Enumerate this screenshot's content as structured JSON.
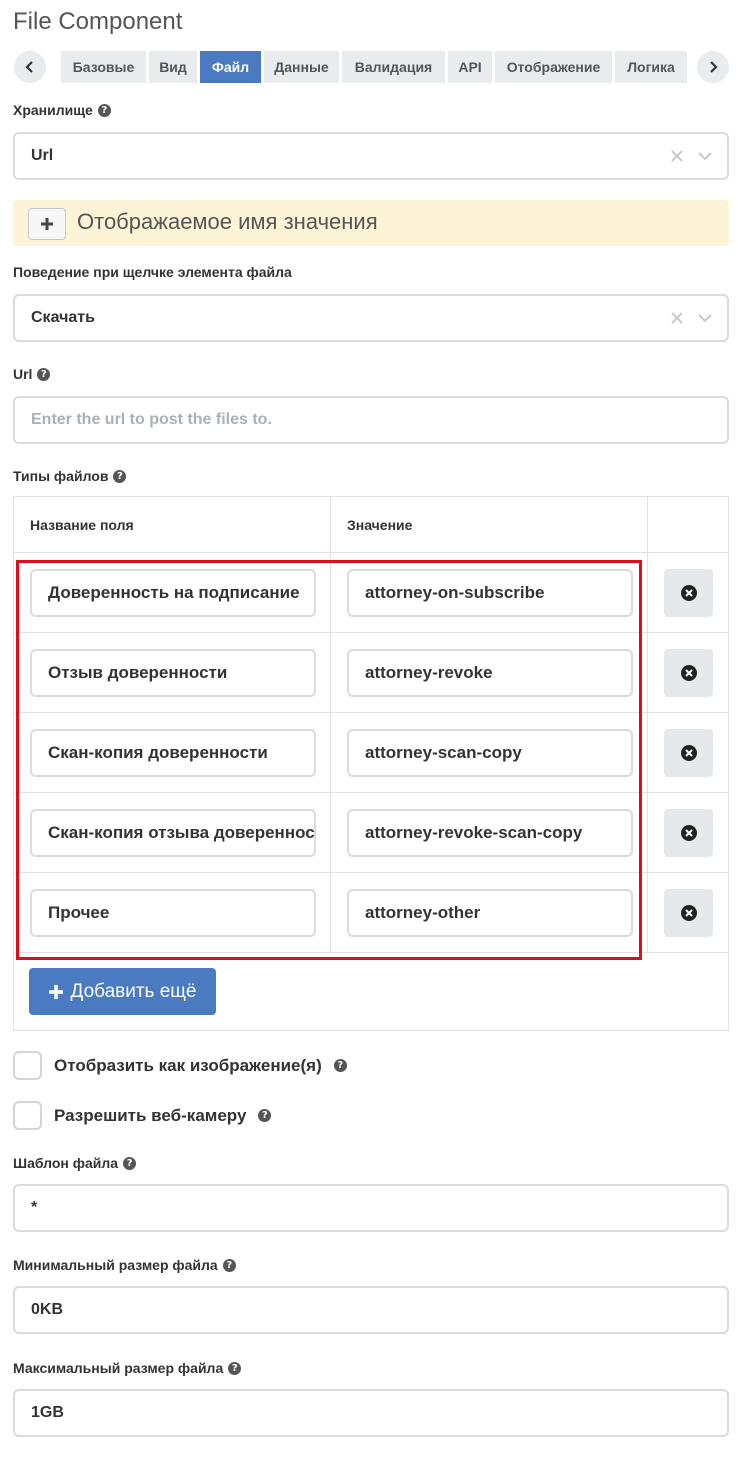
{
  "title": "File Component",
  "tabs": [
    "Базовые",
    "Вид",
    "Файл",
    "Данные",
    "Валидация",
    "API",
    "Отображение",
    "Логика"
  ],
  "active_tab": "Файл",
  "storage": {
    "label": "Хранилище",
    "value": "Url"
  },
  "display_name_notice": "Отображаемое имя значения",
  "click_behavior": {
    "label": "Поведение при щелчке элемента файла",
    "value": "Скачать"
  },
  "url": {
    "label": "Url",
    "placeholder": "Enter the url to post the files to."
  },
  "file_types": {
    "label": "Типы файлов",
    "columns": [
      "Название поля",
      "Значение"
    ],
    "rows": [
      {
        "name": "Доверенность на подписание",
        "value": "attorney-on-subscribe"
      },
      {
        "name": "Отзыв доверенности",
        "value": "attorney-revoke"
      },
      {
        "name": "Скан-копия доверенности",
        "value": "attorney-scan-copy"
      },
      {
        "name": "Скан-копия отзыва доверенности",
        "value": "attorney-revoke-scan-copy"
      },
      {
        "name": "Прочее",
        "value": "attorney-other"
      }
    ],
    "add_button": "Добавить ещё"
  },
  "display_as_image": "Отобразить как изображение(я)",
  "allow_webcam": "Разрешить веб-камеру",
  "file_pattern": {
    "label": "Шаблон файла",
    "value": "*"
  },
  "min_size": {
    "label": "Минимальный размер файла",
    "value": "0KB"
  },
  "max_size": {
    "label": "Максимальный размер файла",
    "value": "1GB"
  },
  "help_glyph": "?",
  "colors": {
    "accent": "#4a7abf",
    "highlight": "#e00b1c",
    "notice_bg": "#fdf4d8"
  }
}
